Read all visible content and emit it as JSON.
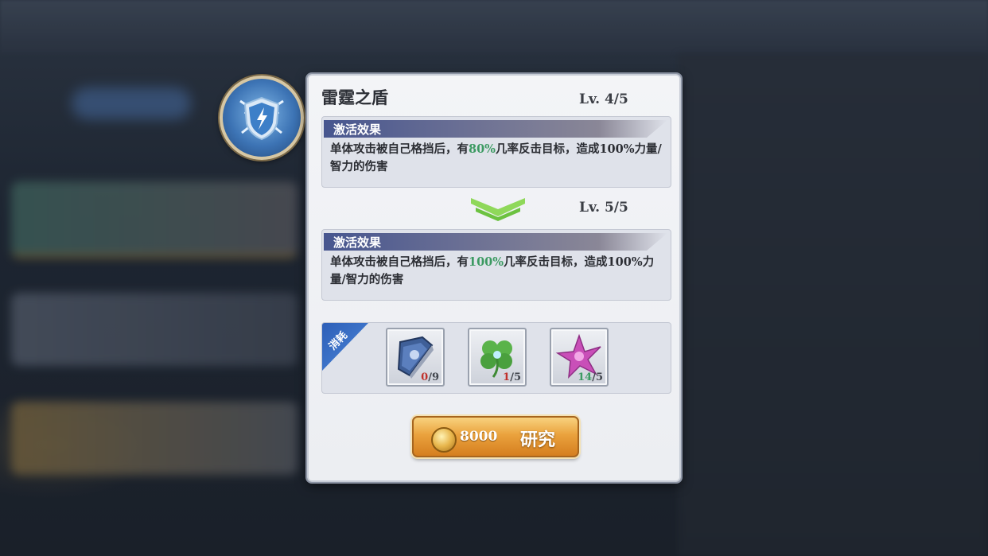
{
  "skill": {
    "name": "雷霆之盾",
    "current_level": "Lv.  4/5",
    "next_level": "Lv.  5/5"
  },
  "effects": [
    {
      "header": "激活效果",
      "text_before": "单体攻击被自己格挡后，有",
      "highlight": "80%",
      "text_after": "几率反击目标，造成100%力量/智力的伤害"
    },
    {
      "header": "激活效果",
      "text_before": "单体攻击被自己格挡后，有",
      "highlight": "100%",
      "text_after": "几率反击目标，造成100%力量/智力的伤害"
    }
  ],
  "consume": {
    "label": "消耗",
    "items": [
      {
        "icon": "book-icon",
        "have": "0",
        "need": "/9",
        "status": "insufficient"
      },
      {
        "icon": "clover-icon",
        "have": "1",
        "need": "/5",
        "status": "insufficient"
      },
      {
        "icon": "flower-icon",
        "have": "14",
        "need": "/5",
        "status": "sufficient"
      }
    ]
  },
  "research_button": {
    "cost": "8000",
    "label": "研究"
  },
  "colors": {
    "highlight_green": "#3c9a62",
    "insufficient_red": "#c0312b",
    "button_orange": "#eaa23d"
  }
}
